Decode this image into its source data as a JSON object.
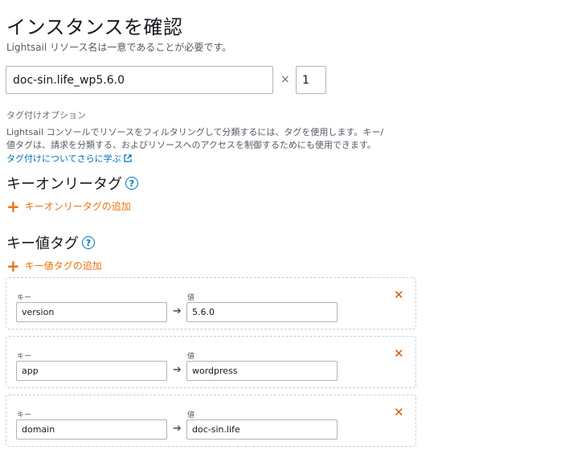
{
  "header": {
    "title": "インスタンスを確認",
    "subtitle": "Lightsail リソース名は一意であることが必要です。"
  },
  "instance": {
    "name_value": "doc-sin.life_wp5.6.0",
    "times": "×",
    "count_value": "1"
  },
  "tagging": {
    "options_label": "タグ付けオプション",
    "description_line1": "Lightsail コンソールでリソースをフィルタリングして分類するには、タグを使用します。キー/",
    "description_line2": "値タグは、請求を分類する、およびリソースへのアクセスを制御するためにも使用できます。",
    "learn_more": "タグ付けについてさらに学ぶ"
  },
  "key_only": {
    "title": "キーオンリータグ",
    "help": "?",
    "add_label": "キーオンリータグの追加",
    "add_icon": "+"
  },
  "key_value": {
    "title": "キー値タグ",
    "help": "?",
    "add_label": "キー値タグの追加",
    "add_icon": "+",
    "key_label": "キー",
    "value_label": "値",
    "arrow": "➔",
    "remove": "✕",
    "tags": [
      {
        "key": "version",
        "value": "5.6.0"
      },
      {
        "key": "app",
        "value": "wordpress"
      },
      {
        "key": "domain",
        "value": "doc-sin.life"
      }
    ]
  }
}
